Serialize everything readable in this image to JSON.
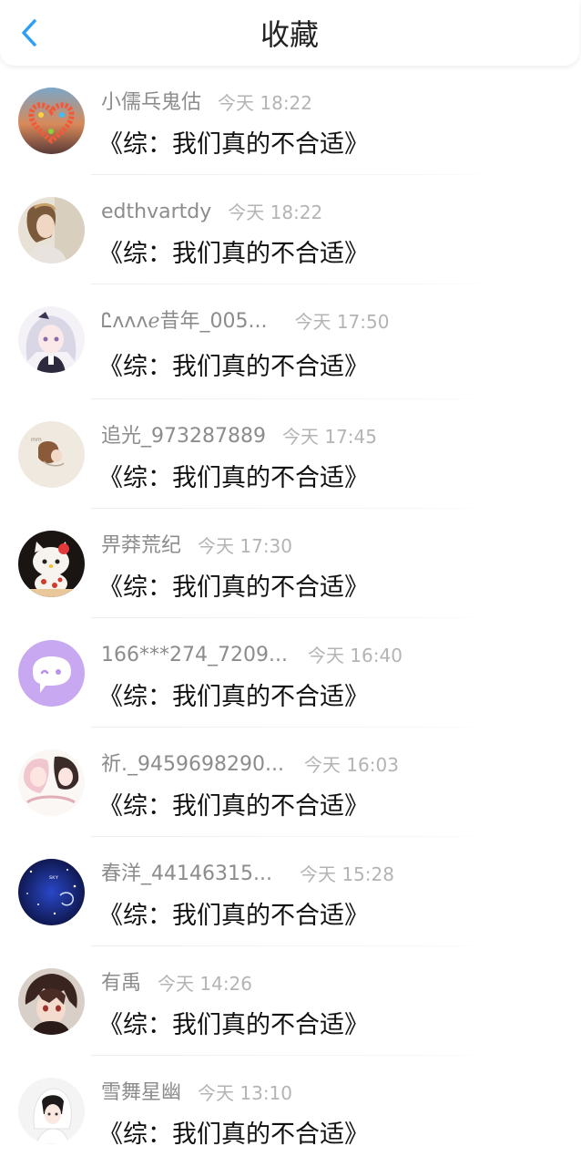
{
  "header": {
    "title": "收藏",
    "accent": "#2f9ff6"
  },
  "items": [
    {
      "name": "小儒乓鬼估",
      "time": "今天 18:22",
      "book": "《综：我们真的不合适》",
      "avatar": "heart-sunset-icon"
    },
    {
      "name": "edthvartdy",
      "time": "今天 18:22",
      "book": "《综：我们真的不合适》",
      "avatar": "girl-portrait-icon"
    },
    {
      "name": "Ꮭᴧᴧᴧℯ昔年_005...",
      "time": "今天 17:50",
      "book": "《综：我们真的不合适》",
      "avatar": "anime-girl-icon"
    },
    {
      "name": "追光_973287889",
      "time": "今天 17:45",
      "book": "《综：我们真的不合适》",
      "avatar": "sketch-girl-icon"
    },
    {
      "name": "畀莽荒纪",
      "time": "今天 17:30",
      "book": "《综：我们真的不合适》",
      "avatar": "hello-kitty-icon"
    },
    {
      "name": "166***274_7209...",
      "time": "今天 16:40",
      "book": "《综：我们真的不合适》",
      "avatar": "chat-bubble-icon"
    },
    {
      "name": "祈._9459698290...",
      "time": "今天 16:03",
      "book": "《综：我们真的不合适》",
      "avatar": "anime-couple-icon"
    },
    {
      "name": "春洋_44146315...",
      "time": "今天 15:28",
      "book": "《综：我们真的不合适》",
      "avatar": "starry-night-icon"
    },
    {
      "name": "有禹",
      "time": "今天 14:26",
      "book": "《综：我们真的不合适》",
      "avatar": "anime-boy-icon"
    },
    {
      "name": "雪舞星幽",
      "time": "今天 13:10",
      "book": "《综：我们真的不合适》",
      "avatar": "white-hood-girl-icon"
    }
  ]
}
